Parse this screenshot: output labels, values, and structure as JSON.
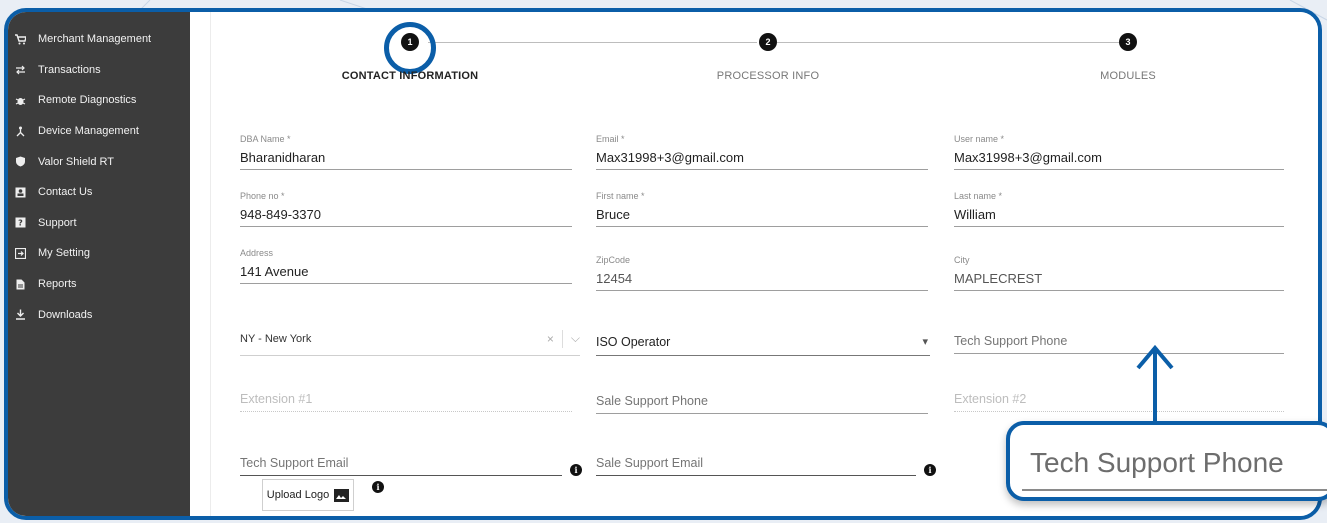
{
  "sidebar": {
    "items": [
      {
        "label": "Merchant Management",
        "icon": "cart-icon"
      },
      {
        "label": "Transactions",
        "icon": "transfer-icon"
      },
      {
        "label": "Remote Diagnostics",
        "icon": "bug-icon"
      },
      {
        "label": "Device Management",
        "icon": "network-icon"
      },
      {
        "label": "Valor Shield RT",
        "icon": "shield-icon"
      },
      {
        "label": "Contact Us",
        "icon": "contact-icon"
      },
      {
        "label": "Support",
        "icon": "help-icon"
      },
      {
        "label": "My Setting",
        "icon": "settings-icon"
      },
      {
        "label": "Reports",
        "icon": "report-icon"
      },
      {
        "label": "Downloads",
        "icon": "download-icon"
      }
    ]
  },
  "stepper": {
    "steps": [
      {
        "number": "1",
        "label": "CONTACT INFORMATION",
        "active": true
      },
      {
        "number": "2",
        "label": "PROCESSOR INFO",
        "active": false
      },
      {
        "number": "3",
        "label": "MODULES",
        "active": false
      }
    ]
  },
  "form": {
    "dba_name": {
      "label": "DBA Name *",
      "value": "Bharanidharan"
    },
    "email": {
      "label": "Email *",
      "value": "Max31998+3@gmail.com"
    },
    "user_name": {
      "label": "User name *",
      "value": "Max31998+3@gmail.com"
    },
    "phone": {
      "label": "Phone no *",
      "value": "948-849-3370"
    },
    "first_name": {
      "label": "First name *",
      "value": "Bruce"
    },
    "last_name": {
      "label": "Last name *",
      "value": "William"
    },
    "address": {
      "label": "Address",
      "value": "141 Avenue"
    },
    "zipcode": {
      "label": "ZipCode",
      "value": "12454"
    },
    "city": {
      "label": "City",
      "value": "MAPLECREST"
    },
    "state": {
      "value": "NY - New York",
      "clear": "×",
      "arrow": "⌵"
    },
    "role": {
      "value": "ISO Operator",
      "arrow": "▾"
    },
    "tech_support_phone": {
      "placeholder": "Tech Support Phone"
    },
    "extension1": {
      "placeholder": "Extension #1"
    },
    "sale_support_phone": {
      "placeholder": "Sale Support Phone"
    },
    "extension2": {
      "placeholder": "Extension #2"
    },
    "tech_support_email": {
      "placeholder": "Tech Support Email"
    },
    "sale_support_email": {
      "placeholder": "Sale Support Email"
    },
    "upload_logo": {
      "label": "Upload Logo"
    },
    "info_glyph": "i"
  },
  "callout": {
    "text": "Tech Support Phone"
  },
  "colors": {
    "accent": "#0b5ea8",
    "sidebar": "#3c3c3c"
  }
}
